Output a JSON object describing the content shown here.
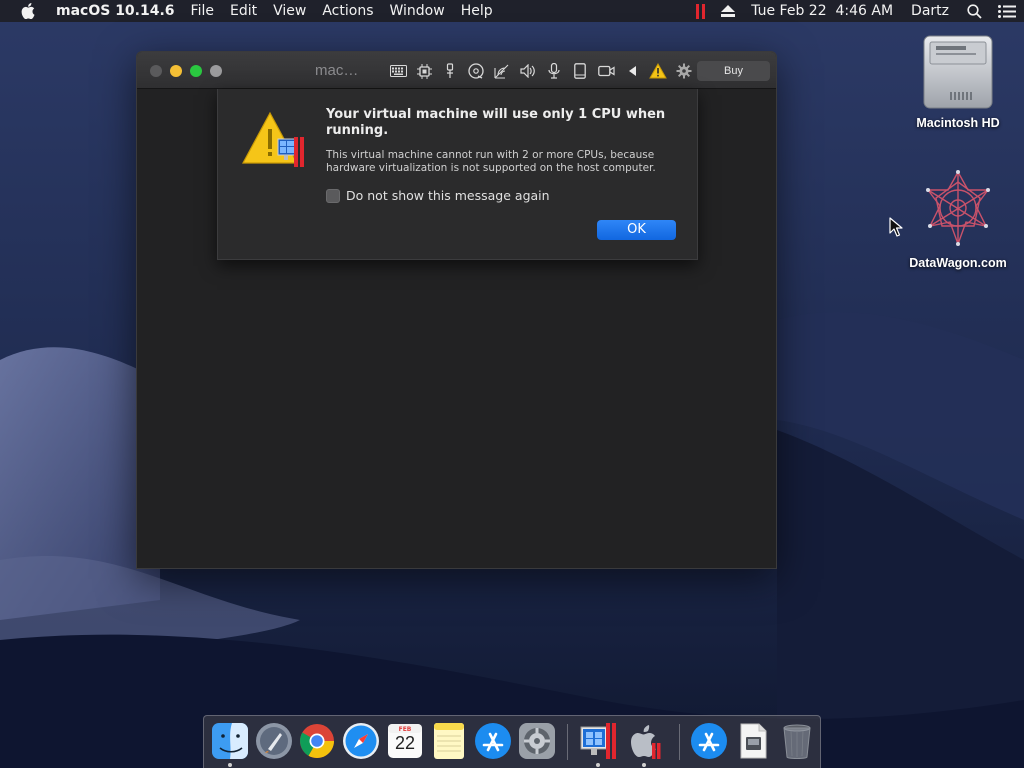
{
  "menubar": {
    "app_name": "macOS 10.14.6",
    "items": [
      "File",
      "Edit",
      "View",
      "Actions",
      "Window",
      "Help"
    ],
    "datetime": "Tue Feb 22  4:46 AM",
    "user": "Dartz"
  },
  "window": {
    "title": "mac…",
    "buy_label": "Buy",
    "toolbar_icons": [
      "keyboard-icon",
      "cpu-icon",
      "usb-icon",
      "cd-icon",
      "network-icon",
      "speaker-icon",
      "microphone-icon",
      "tablet-icon",
      "camera-icon",
      "play-left-icon",
      "warning-icon",
      "gear-icon"
    ]
  },
  "alert": {
    "title": "Your virtual machine will use only 1 CPU when running.",
    "message": "This virtual machine cannot run with 2 or more CPUs, because hardware virtualization is not supported on the host computer.",
    "checkbox_label": "Do not show this message again",
    "checkbox_checked": false,
    "ok_label": "OK"
  },
  "desktop": {
    "icons": [
      {
        "label": "Macintosh HD",
        "icon": "hard-drive-icon"
      },
      {
        "label": "DataWagon.com",
        "icon": "datawagon-logo-icon"
      }
    ]
  },
  "dock": {
    "items": [
      "finder-icon",
      "launchpad-icon",
      "chrome-icon",
      "safari-icon",
      "calendar-icon",
      "notes-icon",
      "app-store-icon",
      "system-preferences-icon",
      "parallels-desktop-icon",
      "macos-installer-icon",
      "app-store-downloads-icon",
      "file-icon",
      "trash-icon"
    ],
    "calendar": {
      "month": "FEB",
      "day": "22"
    }
  },
  "colors": {
    "accent": "#1a6fe8",
    "parallels_red": "#e1262e",
    "warning_yellow": "#f5c518"
  }
}
